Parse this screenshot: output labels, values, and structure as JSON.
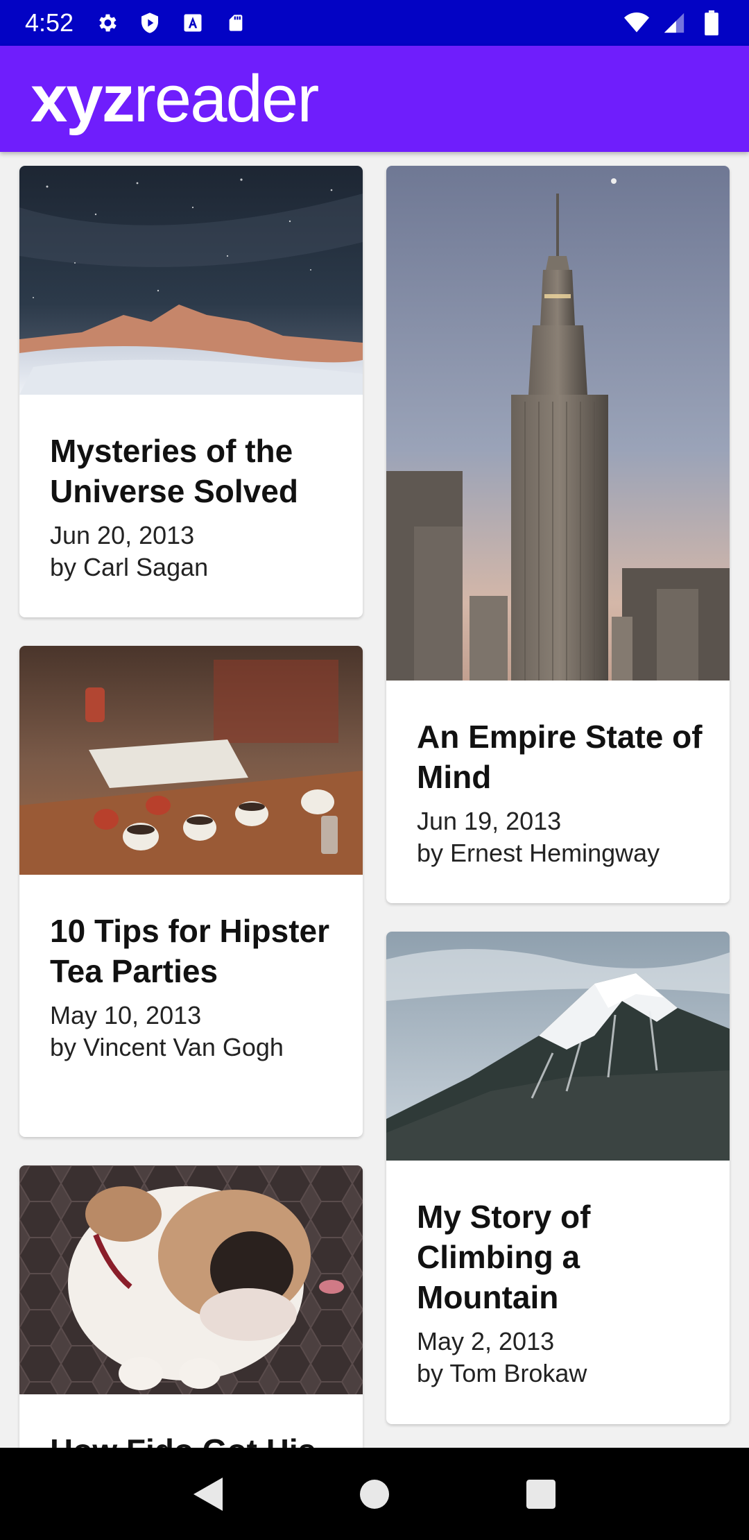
{
  "status_bar": {
    "time": "4:52",
    "icons_left": [
      "gear-icon",
      "play-protect-icon",
      "a-badge-icon",
      "sd-card-icon"
    ],
    "icons_right": [
      "wifi-icon",
      "signal-icon",
      "battery-icon"
    ]
  },
  "app_bar": {
    "logo_bold": "xyz",
    "logo_light": "reader"
  },
  "articles": [
    {
      "title": "Mysteries of the Universe Solved",
      "date": "Jun 20, 2013",
      "author": "by Carl Sagan"
    },
    {
      "title": "An Empire State of Mind",
      "date": "Jun 19, 2013",
      "author": "by Ernest Hemingway"
    },
    {
      "title": "10 Tips for Hipster Tea Parties",
      "date": "May 10, 2013",
      "author": "by Vincent Van Gogh"
    },
    {
      "title": "My Story of Climbing a Mountain",
      "date": "May 2, 2013",
      "author": "by Tom Brokaw"
    },
    {
      "title": "How Fido Got His",
      "date": "",
      "author": ""
    }
  ],
  "nav_bar": {
    "icons": [
      "back-icon",
      "home-icon",
      "recents-icon"
    ]
  },
  "colors": {
    "status_bar": "#0303c4",
    "app_bar": "#6f1efc",
    "background": "#f1f1f1"
  }
}
